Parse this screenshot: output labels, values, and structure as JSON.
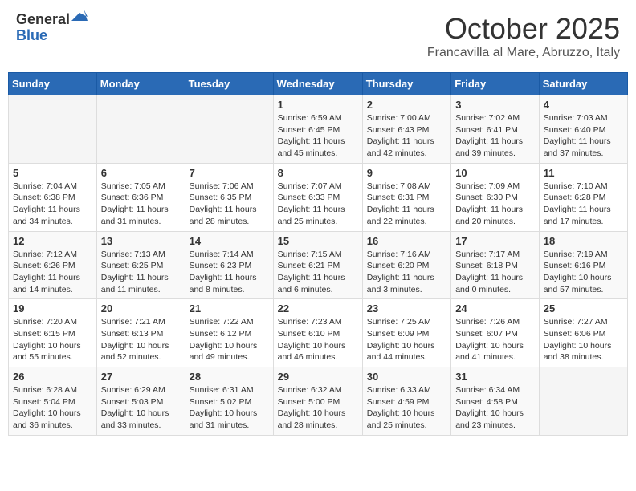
{
  "header": {
    "logo_general": "General",
    "logo_blue": "Blue",
    "title": "October 2025",
    "location": "Francavilla al Mare, Abruzzo, Italy"
  },
  "days_of_week": [
    "Sunday",
    "Monday",
    "Tuesday",
    "Wednesday",
    "Thursday",
    "Friday",
    "Saturday"
  ],
  "weeks": [
    [
      {
        "day": "",
        "info": ""
      },
      {
        "day": "",
        "info": ""
      },
      {
        "day": "",
        "info": ""
      },
      {
        "day": "1",
        "info": "Sunrise: 6:59 AM\nSunset: 6:45 PM\nDaylight: 11 hours\nand 45 minutes."
      },
      {
        "day": "2",
        "info": "Sunrise: 7:00 AM\nSunset: 6:43 PM\nDaylight: 11 hours\nand 42 minutes."
      },
      {
        "day": "3",
        "info": "Sunrise: 7:02 AM\nSunset: 6:41 PM\nDaylight: 11 hours\nand 39 minutes."
      },
      {
        "day": "4",
        "info": "Sunrise: 7:03 AM\nSunset: 6:40 PM\nDaylight: 11 hours\nand 37 minutes."
      }
    ],
    [
      {
        "day": "5",
        "info": "Sunrise: 7:04 AM\nSunset: 6:38 PM\nDaylight: 11 hours\nand 34 minutes."
      },
      {
        "day": "6",
        "info": "Sunrise: 7:05 AM\nSunset: 6:36 PM\nDaylight: 11 hours\nand 31 minutes."
      },
      {
        "day": "7",
        "info": "Sunrise: 7:06 AM\nSunset: 6:35 PM\nDaylight: 11 hours\nand 28 minutes."
      },
      {
        "day": "8",
        "info": "Sunrise: 7:07 AM\nSunset: 6:33 PM\nDaylight: 11 hours\nand 25 minutes."
      },
      {
        "day": "9",
        "info": "Sunrise: 7:08 AM\nSunset: 6:31 PM\nDaylight: 11 hours\nand 22 minutes."
      },
      {
        "day": "10",
        "info": "Sunrise: 7:09 AM\nSunset: 6:30 PM\nDaylight: 11 hours\nand 20 minutes."
      },
      {
        "day": "11",
        "info": "Sunrise: 7:10 AM\nSunset: 6:28 PM\nDaylight: 11 hours\nand 17 minutes."
      }
    ],
    [
      {
        "day": "12",
        "info": "Sunrise: 7:12 AM\nSunset: 6:26 PM\nDaylight: 11 hours\nand 14 minutes."
      },
      {
        "day": "13",
        "info": "Sunrise: 7:13 AM\nSunset: 6:25 PM\nDaylight: 11 hours\nand 11 minutes."
      },
      {
        "day": "14",
        "info": "Sunrise: 7:14 AM\nSunset: 6:23 PM\nDaylight: 11 hours\nand 8 minutes."
      },
      {
        "day": "15",
        "info": "Sunrise: 7:15 AM\nSunset: 6:21 PM\nDaylight: 11 hours\nand 6 minutes."
      },
      {
        "day": "16",
        "info": "Sunrise: 7:16 AM\nSunset: 6:20 PM\nDaylight: 11 hours\nand 3 minutes."
      },
      {
        "day": "17",
        "info": "Sunrise: 7:17 AM\nSunset: 6:18 PM\nDaylight: 11 hours\nand 0 minutes."
      },
      {
        "day": "18",
        "info": "Sunrise: 7:19 AM\nSunset: 6:16 PM\nDaylight: 10 hours\nand 57 minutes."
      }
    ],
    [
      {
        "day": "19",
        "info": "Sunrise: 7:20 AM\nSunset: 6:15 PM\nDaylight: 10 hours\nand 55 minutes."
      },
      {
        "day": "20",
        "info": "Sunrise: 7:21 AM\nSunset: 6:13 PM\nDaylight: 10 hours\nand 52 minutes."
      },
      {
        "day": "21",
        "info": "Sunrise: 7:22 AM\nSunset: 6:12 PM\nDaylight: 10 hours\nand 49 minutes."
      },
      {
        "day": "22",
        "info": "Sunrise: 7:23 AM\nSunset: 6:10 PM\nDaylight: 10 hours\nand 46 minutes."
      },
      {
        "day": "23",
        "info": "Sunrise: 7:25 AM\nSunset: 6:09 PM\nDaylight: 10 hours\nand 44 minutes."
      },
      {
        "day": "24",
        "info": "Sunrise: 7:26 AM\nSunset: 6:07 PM\nDaylight: 10 hours\nand 41 minutes."
      },
      {
        "day": "25",
        "info": "Sunrise: 7:27 AM\nSunset: 6:06 PM\nDaylight: 10 hours\nand 38 minutes."
      }
    ],
    [
      {
        "day": "26",
        "info": "Sunrise: 6:28 AM\nSunset: 5:04 PM\nDaylight: 10 hours\nand 36 minutes."
      },
      {
        "day": "27",
        "info": "Sunrise: 6:29 AM\nSunset: 5:03 PM\nDaylight: 10 hours\nand 33 minutes."
      },
      {
        "day": "28",
        "info": "Sunrise: 6:31 AM\nSunset: 5:02 PM\nDaylight: 10 hours\nand 31 minutes."
      },
      {
        "day": "29",
        "info": "Sunrise: 6:32 AM\nSunset: 5:00 PM\nDaylight: 10 hours\nand 28 minutes."
      },
      {
        "day": "30",
        "info": "Sunrise: 6:33 AM\nSunset: 4:59 PM\nDaylight: 10 hours\nand 25 minutes."
      },
      {
        "day": "31",
        "info": "Sunrise: 6:34 AM\nSunset: 4:58 PM\nDaylight: 10 hours\nand 23 minutes."
      },
      {
        "day": "",
        "info": ""
      }
    ]
  ]
}
